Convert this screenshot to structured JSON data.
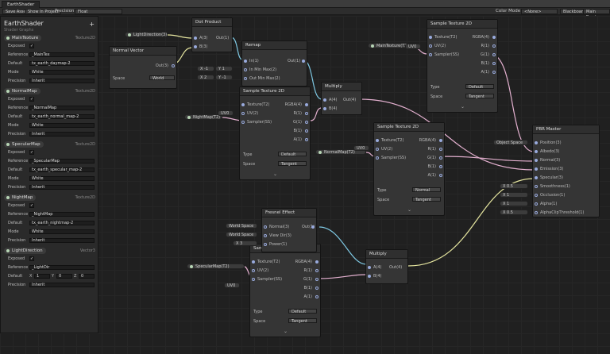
{
  "window": {
    "tab": "EarthShader"
  },
  "toolbar": {
    "save": "Save Asset",
    "show": "Show In Project",
    "precision_label": "Precision",
    "precision": "Float",
    "colormode_label": "Color Mode",
    "colormode": "<None>",
    "blackboard": "Blackboard",
    "preview": "Main Preview"
  },
  "blackboard": {
    "title": "EarthShader",
    "subtitle": "Shader Graphs",
    "props": [
      {
        "name": "MainTexture",
        "type": "Texture2D",
        "exposed": "✓",
        "reference": "_MainTex",
        "default": "tx_earth_daymap-2",
        "mode": "White",
        "precision": "Inherit"
      },
      {
        "name": "NormalMap",
        "type": "Texture2D",
        "exposed": "✓",
        "reference": "_NormalMap",
        "default": "tx_earth_normal_map-2",
        "mode": "White",
        "precision": "Inherit"
      },
      {
        "name": "SpecularMap",
        "type": "Texture2D",
        "exposed": "✓",
        "reference": "_SpecularMap",
        "default": "tx_earth_specular_map-2",
        "mode": "White",
        "precision": "Inherit"
      },
      {
        "name": "NightMap",
        "type": "Texture2D",
        "exposed": "✓",
        "reference": "_NightMap",
        "default": "tx_earth_nightmap-2",
        "mode": "White",
        "precision": "Inherit"
      }
    ],
    "light": {
      "name": "LightDirection",
      "type": "Vector3",
      "exposed": "✓",
      "reference": "_LightDir",
      "x": "1",
      "y": "0",
      "z": "0",
      "precision": "Inherit"
    },
    "labels": {
      "exposed": "Exposed",
      "reference": "Reference",
      "default": "Default",
      "mode": "Mode",
      "precision": "Precision",
      "x": "X",
      "y": "Y",
      "z": "Z"
    }
  },
  "nodes": {
    "dot": {
      "title": "Dot Product",
      "a": "A(3)",
      "b": "B(3)",
      "out": "Out(1)"
    },
    "normal": {
      "title": "Normal Vector",
      "out": "Out(3)",
      "space": "Space",
      "space_val": "World"
    },
    "remap": {
      "title": "Remap",
      "in": "In(1)",
      "inmm": "In Min Max(2)",
      "outmm": "Out Min Max(2)",
      "out": "Out(1)",
      "x1": "X  -1",
      "y1": "Y  1",
      "x2": "X  2",
      "y2": "Y  -1"
    },
    "multiply1": {
      "title": "Multiply",
      "a": "A(4)",
      "b": "B(4)",
      "out": "Out(4)"
    },
    "sample_main": {
      "title": "Sample Texture 2D",
      "tex": "Texture(T2)",
      "uv": "UV(2)",
      "ss": "Sampler(SS)",
      "rgba": "RGBA(4)",
      "r": "R(1)",
      "g": "G(1)",
      "b": "B(1)",
      "a": "A(1)",
      "type": "Type",
      "type_val": "Default",
      "space": "Space",
      "space_val": "Tangent"
    },
    "sample_night": {
      "title": "Sample Texture 2D",
      "tex": "Texture(T2)",
      "uv": "UV(2)",
      "ss": "Sampler(SS)",
      "rgba": "RGBA(4)",
      "r": "R(1)",
      "g": "G(1)",
      "b": "B(1)",
      "a": "A(1)",
      "type": "Type",
      "type_val": "Default",
      "space": "Space",
      "space_val": "Tangent"
    },
    "sample_normal": {
      "title": "Sample Texture 2D",
      "tex": "Texture(T2)",
      "uv": "UV(2)",
      "ss": "Sampler(SS)",
      "rgba": "RGBA(4)",
      "r": "R(1)",
      "g": "G(1)",
      "b": "B(1)",
      "a": "A(1)",
      "type": "Type",
      "type_val": "Normal",
      "space": "Space",
      "space_val": "Tangent"
    },
    "sample_spec": {
      "title": "Sample Texture 2D",
      "tex": "Texture(T2)",
      "uv": "UV(2)",
      "ss": "Sampler(SS)",
      "rgba": "RGBA(4)",
      "r": "R(1)",
      "g": "G(1)",
      "b": "B(1)",
      "a": "A(1)",
      "type": "Type",
      "type_val": "Default",
      "space": "Space",
      "space_val": "Tangent"
    },
    "fresnel": {
      "title": "Fresnel Effect",
      "normal": "Normal(3)",
      "view": "View Dir(3)",
      "power": "Power(1)",
      "out": "Out(1)",
      "ws1": "World Space",
      "ws2": "World Space",
      "x": "X  3"
    },
    "multiply2": {
      "title": "Multiply",
      "a": "A(4)",
      "b": "B(4)",
      "out": "Out(4)"
    },
    "pbr": {
      "title": "PBR Master",
      "ports": [
        "Position(3)",
        "Albedo(3)",
        "Normal(3)",
        "Emission(3)",
        "Specular(3)",
        "Smoothness(1)",
        "Occlusion(1)",
        "Alpha(1)",
        "AlphaClipThreshold(1)"
      ],
      "objspace": "Object Space",
      "x1": "X  0.5",
      "x2": "X  1",
      "x3": "X  1",
      "x4": "X  0.5"
    }
  },
  "props_nodes": {
    "light": "LightDirection(3)",
    "main": "MainTexture(T2)",
    "night": "NightMap(T2)",
    "normal": "NormalMap(T2)",
    "spec": "SpecularMap(T2)",
    "uv": "UV0"
  },
  "colors": {
    "canvas": "#202020",
    "node": "#353535",
    "wire_blue": "#7ec8e3",
    "wire_pink": "#e3b0cf",
    "wire_yellow": "#e6e6a0"
  }
}
